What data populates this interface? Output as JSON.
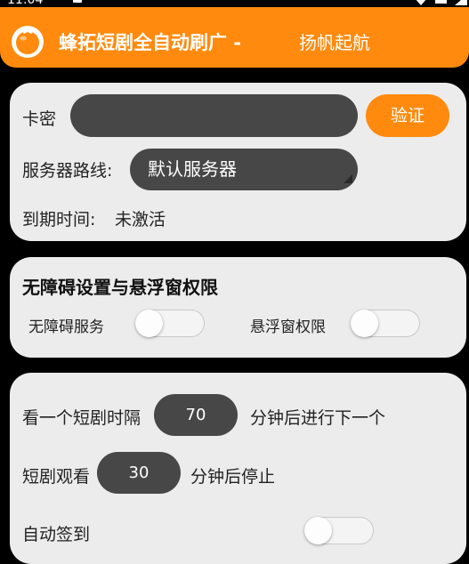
{
  "status": {
    "time": "11:04"
  },
  "appbar": {
    "title": "蜂拓短剧全自动刷广 -",
    "subtitle": "扬帆起航",
    "logo_icon": "tomato-icon"
  },
  "auth_card": {
    "card_key_label": "卡密",
    "card_key_value": "",
    "verify_button": "验证",
    "server_label": "服务器路线:",
    "server_value": "默认服务器",
    "expiry_label": "到期时间:",
    "expiry_value": "未激活"
  },
  "permissions_card": {
    "title": "无障碍设置与悬浮窗权限",
    "accessibility_label": "无障碍服务",
    "accessibility_on": false,
    "overlay_label": "悬浮窗权限",
    "overlay_on": false
  },
  "schedule_card": {
    "interval_prefix": "看一个短剧时隔",
    "interval_value": "70",
    "interval_suffix": "分钟后进行下一个",
    "watch_prefix": "短剧观看",
    "watch_value": "30",
    "watch_suffix": "分钟后停止",
    "auto_checkin_label": "自动签到",
    "auto_checkin_on": false
  },
  "colors": {
    "accent": "#ff8a0d",
    "card": "#ececec",
    "field": "#474747",
    "background": "#000000"
  }
}
